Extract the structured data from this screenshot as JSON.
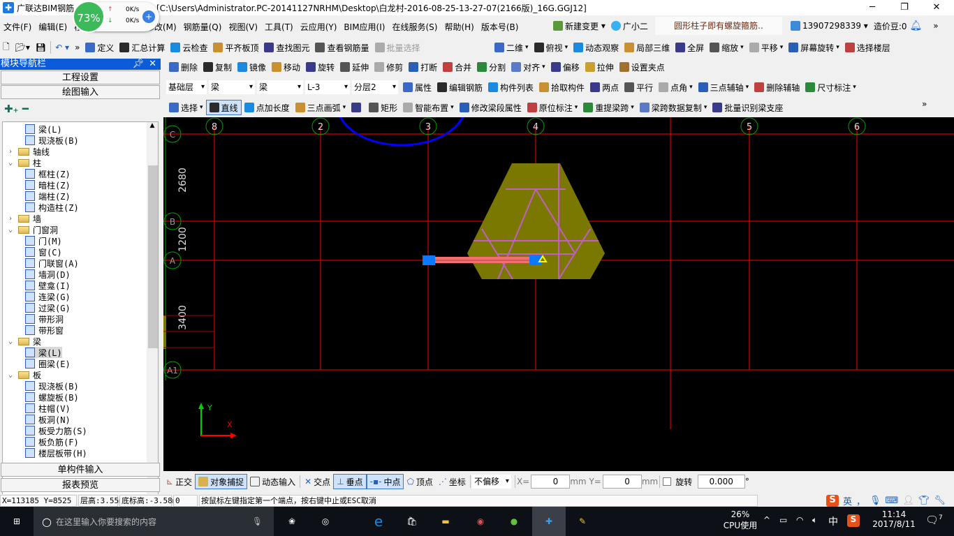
{
  "title": {
    "app": "广联达BIM钢筋",
    "path": "[C:\\Users\\Administrator.PC-20141127NRHM\\Desktop\\白龙村-2016-08-25-13-27-07(2166版)_16G.GGJ12]",
    "min": "─",
    "max": "❐",
    "close": "✕"
  },
  "netwidget": {
    "percent": "73%",
    "up": "0K/s",
    "down": "0K/s"
  },
  "menu": [
    "文件(F)",
    "编辑(E)",
    "楼层(L)",
    "绘图(D)",
    "修改(M)",
    "钢筋量(Q)",
    "视图(V)",
    "工具(T)",
    "云应用(Y)",
    "BIM应用(I)",
    "在线服务(S)",
    "帮助(H)",
    "版本号(B)"
  ],
  "menu_extra": {
    "new_change": "新建变更",
    "assistant": "广小二",
    "notice": "圆形柱子即有螺旋箍筋..",
    "phone": "13907298339",
    "beans": "造价豆:0"
  },
  "toolbar1": [
    "定义",
    "汇总计算",
    "云检查",
    "平齐板顶",
    "查找图元",
    "查看钢筋量",
    "批量选择"
  ],
  "toolbar1_right": [
    "二维",
    "俯视",
    "动态观察",
    "局部三维",
    "全屏",
    "缩放",
    "平移",
    "屏幕旋转",
    "选择楼层"
  ],
  "edit_toolbar": [
    "删除",
    "复制",
    "镜像",
    "移动",
    "旋转",
    "延伸",
    "修剪",
    "打断",
    "合并",
    "分割",
    "对齐",
    "偏移",
    "拉伸",
    "设置夹点"
  ],
  "selectors": {
    "floor": "基础层",
    "type": "梁",
    "sub": "梁",
    "name": "L-3",
    "layer": "分层2"
  },
  "prop_toolbar": [
    "属性",
    "编辑钢筋",
    "构件列表",
    "拾取构件",
    "两点",
    "平行",
    "点角",
    "三点辅轴",
    "删除辅轴",
    "尺寸标注"
  ],
  "draw_toolbar": [
    "选择",
    "直线",
    "点加长度",
    "三点画弧",
    "",
    "矩形",
    "智能布置",
    "修改梁段属性",
    "原位标注",
    "重提梁跨",
    "梁跨数据复制",
    "批量识别梁支座"
  ],
  "sidebar": {
    "title": "模块导航栏",
    "engineering": "工程设置",
    "drawing": "绘图输入",
    "single": "单构件输入",
    "report": "报表预览",
    "tree": [
      {
        "label": "梁(L)",
        "level": 2
      },
      {
        "label": "现浇板(B)",
        "level": 2
      },
      {
        "label": "轴线",
        "level": 1,
        "folder": true,
        "expanded": false
      },
      {
        "label": "柱",
        "level": 1,
        "folder": true,
        "expanded": true
      },
      {
        "label": "框柱(Z)",
        "level": 2
      },
      {
        "label": "暗柱(Z)",
        "level": 2
      },
      {
        "label": "端柱(Z)",
        "level": 2
      },
      {
        "label": "构造柱(Z)",
        "level": 2
      },
      {
        "label": "墙",
        "level": 1,
        "folder": true,
        "expanded": false
      },
      {
        "label": "门窗洞",
        "level": 1,
        "folder": true,
        "expanded": true
      },
      {
        "label": "门(M)",
        "level": 2
      },
      {
        "label": "窗(C)",
        "level": 2
      },
      {
        "label": "门联窗(A)",
        "level": 2
      },
      {
        "label": "墙洞(D)",
        "level": 2
      },
      {
        "label": "壁龛(I)",
        "level": 2
      },
      {
        "label": "连梁(G)",
        "level": 2
      },
      {
        "label": "过梁(G)",
        "level": 2
      },
      {
        "label": "带形洞",
        "level": 2
      },
      {
        "label": "带形窗",
        "level": 2
      },
      {
        "label": "梁",
        "level": 1,
        "folder": true,
        "expanded": true
      },
      {
        "label": "梁(L)",
        "level": 2,
        "selected": true
      },
      {
        "label": "圈梁(E)",
        "level": 2
      },
      {
        "label": "板",
        "level": 1,
        "folder": true,
        "expanded": true
      },
      {
        "label": "现浇板(B)",
        "level": 2
      },
      {
        "label": "螺旋板(B)",
        "level": 2
      },
      {
        "label": "柱帽(V)",
        "level": 2
      },
      {
        "label": "板洞(N)",
        "level": 2
      },
      {
        "label": "板受力筋(S)",
        "level": 2
      },
      {
        "label": "板负筋(F)",
        "level": 2
      },
      {
        "label": "楼层板带(H)",
        "level": 2
      }
    ]
  },
  "canvas": {
    "col_axes": [
      "8",
      "2",
      "3",
      "4",
      "5",
      "6"
    ],
    "row_axes": [
      "C",
      "B",
      "A",
      "A1"
    ],
    "dims": [
      "2680",
      "1200",
      "3400"
    ],
    "ucs_x": "X",
    "ucs_y": "Y",
    "colors": {
      "grid": "#ff0000",
      "axis_circle": "#00a000",
      "slab": "#7a7800",
      "rebar": "#c060c0",
      "beam": "#f07070",
      "grip": "#0a78ff",
      "annotation": "#0000ff"
    }
  },
  "bottom": {
    "ortho": "正交",
    "snap": "对象捕捉",
    "dyn": "动态输入",
    "intersect": "交点",
    "perp": "垂点",
    "mid": "中点",
    "vertex": "顶点",
    "coord": "坐标",
    "offset": "不偏移",
    "x_label": "X=",
    "x": "0",
    "mm1": "mm",
    "y_label": "Y=",
    "y": "0",
    "mm2": "mm",
    "rotate": "旋转",
    "angle": "0.000",
    "deg": "°"
  },
  "status": {
    "coords": "X=113185 Y=8525",
    "floor_h": "层高:3.55m",
    "base_h": "底标高:-3.58m",
    "val": "0",
    "hint": "按鼠标左键指定第一个端点，按右键中止或ESC取消"
  },
  "ime": {
    "lang": "英",
    "punct": "，"
  },
  "taskbar": {
    "search": "在这里输入你要搜索的内容",
    "cpu": "26%",
    "cpu_label": "CPU使用",
    "ime": "中",
    "time": "11:14",
    "date": "2017/8/11",
    "notif": "7"
  }
}
